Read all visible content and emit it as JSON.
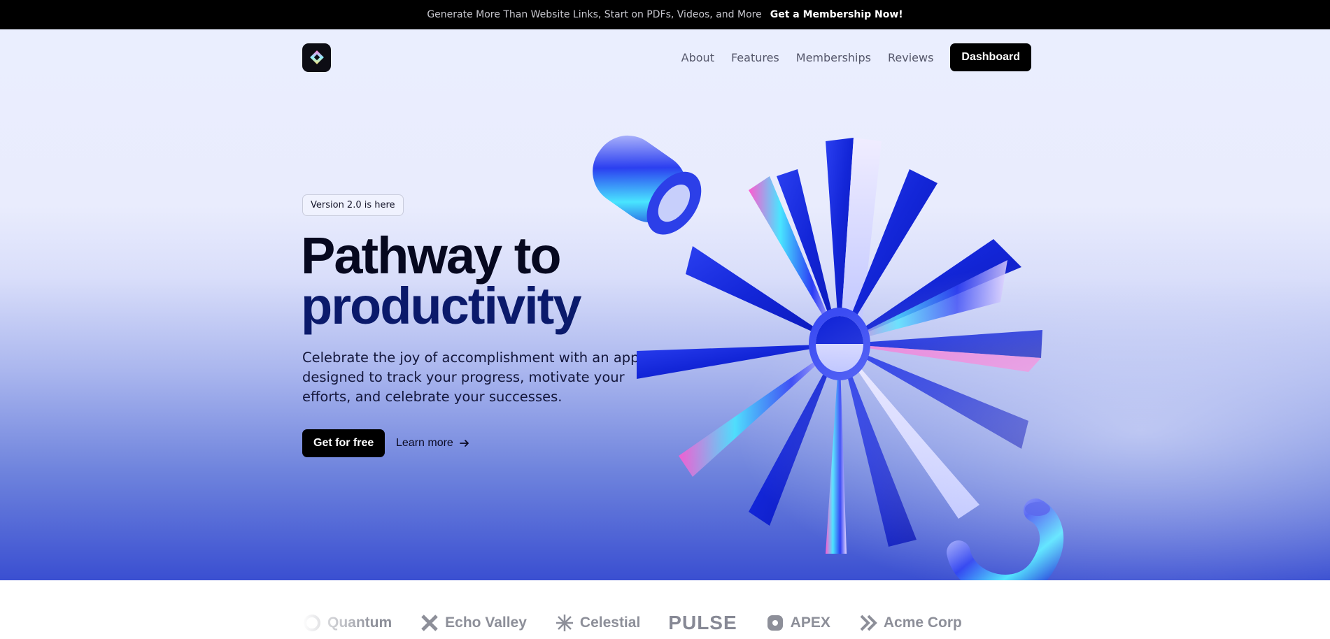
{
  "announcement": {
    "message": "Generate More Than Website Links, Start on PDFs, Videos, and More",
    "cta": "Get a Membership Now!"
  },
  "nav": {
    "logo_icon": "diamond-logo-icon",
    "links": [
      "About",
      "Features",
      "Memberships",
      "Reviews"
    ],
    "dashboard_label": "Dashboard"
  },
  "hero": {
    "badge": "Version 2.0 is here",
    "title_line1": "Pathway to",
    "title_line2": "productivity",
    "description": "Celebrate the joy of accomplishment with an app designed to track your progress, motivate your efforts, and celebrate your successes.",
    "primary_cta": "Get for free",
    "secondary_cta": "Learn more",
    "secondary_icon": "arrow-right-icon"
  },
  "logos": [
    "Quantum",
    "Echo Valley",
    "Celestial",
    "PULSE",
    "APEX",
    "Acme Corp"
  ],
  "colors": {
    "accent": "#1f35d6",
    "background_top": "#eaeefe",
    "background_bottom": "#3a4fd1"
  }
}
